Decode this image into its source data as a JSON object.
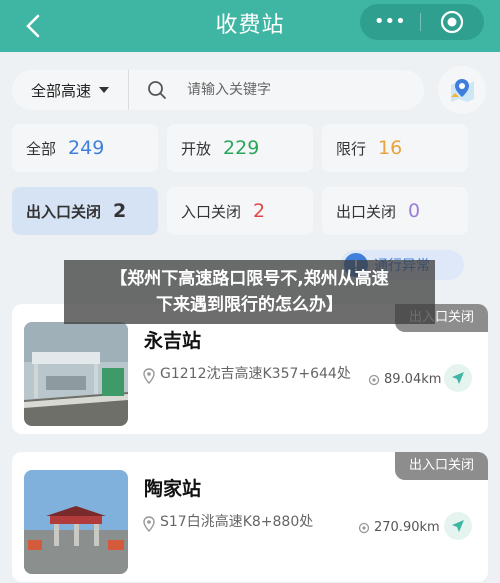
{
  "header": {
    "title": "收费站",
    "back_icon": "chevron-left-icon",
    "more_icon": "more-dots-icon",
    "target_icon": "target-icon"
  },
  "search": {
    "type_selected": "全部高速",
    "placeholder": "请输入关键字"
  },
  "filters": [
    {
      "label": "全部",
      "count": "249"
    },
    {
      "label": "开放",
      "count": "229"
    },
    {
      "label": "限行",
      "count": "16"
    },
    {
      "label": "出入口关闭",
      "count": "2"
    },
    {
      "label": "入口关闭",
      "count": "2"
    },
    {
      "label": "出口关闭",
      "count": "0"
    }
  ],
  "exception_button": {
    "label": "通行异常"
  },
  "overlay": {
    "line1": "【郑州下高速路口限号不,郑州从高速",
    "line2": "下来遇到限行的怎么办】"
  },
  "stations": [
    {
      "name": "永吉站",
      "route": "G1212沈吉高速K357+644处",
      "distance": "89.04km",
      "status": "出入口关闭"
    },
    {
      "name": "陶家站",
      "route": "S17白洮高速K8+880处",
      "distance": "270.90km",
      "status": "出入口关闭"
    }
  ],
  "colors": {
    "header": "#3fb6a4",
    "accent_blue": "#3f7fdb"
  }
}
